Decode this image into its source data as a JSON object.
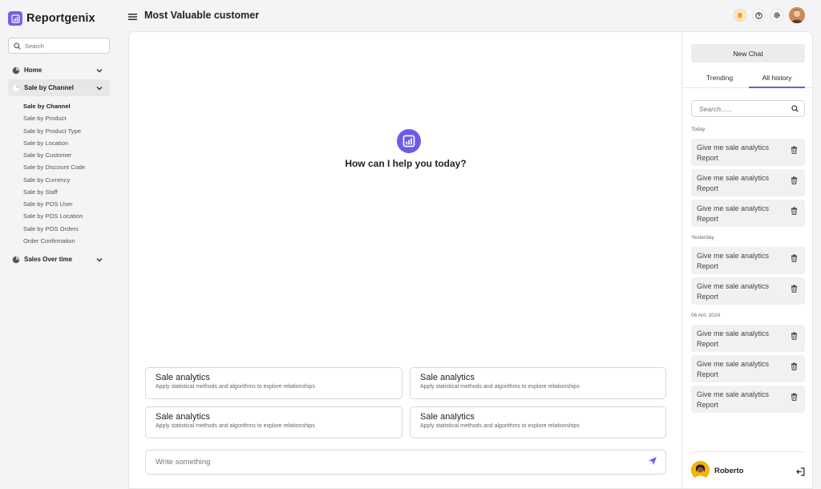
{
  "brand": {
    "name": "Reportgenix",
    "color": "#7262e8"
  },
  "sidebar": {
    "search_placeholder": "Search",
    "groups": [
      {
        "label": "Home"
      },
      {
        "label": "Sale by Channel"
      },
      {
        "label": "Sales Over time"
      }
    ],
    "sub_items": [
      "Sale by Channel",
      "Sale by Product",
      "Sale by Product Type",
      "Sale by Location",
      "Sale by Customer",
      "Sale by Discount Code",
      "Sale by Currency",
      "Sale by Staff",
      "Sale by POS User",
      "Sale by POS Location",
      "Sale by POS Orders",
      "Order Confirmation"
    ]
  },
  "header": {
    "title": "Most Valuable customer"
  },
  "main": {
    "greeting": "How can I help you today?",
    "cards": [
      {
        "title": "Sale analytics",
        "desc": "Apply statistical methods and algorithms to explore relationships"
      },
      {
        "title": "Sale analytics",
        "desc": "Apply statistical methods and algorithms to explore relationships"
      },
      {
        "title": "Sale analytics",
        "desc": "Apply statistical methods and algorithms to explore relationships"
      },
      {
        "title": "Sale analytics",
        "desc": "Apply statistical methods and algorithms to explore relationships"
      }
    ],
    "composer_placeholder": "Write something"
  },
  "history_panel": {
    "new_chat_label": "New Chat",
    "tabs": [
      "Trending",
      "All history"
    ],
    "active_tab": "All history",
    "search_placeholder": "Search......",
    "sections": [
      {
        "label": "Today",
        "items": [
          "Give me sale analytics Report",
          "Give me sale analytics Report",
          "Give me sale analytics Report"
        ]
      },
      {
        "label": "Yesterday",
        "items": [
          "Give me sale analytics Report",
          "Give me sale analytics Report"
        ]
      },
      {
        "label": "06 Aril, 2024",
        "items": [
          "Give me sale analytics Report",
          "Give me sale analytics Report",
          "Give me sale analytics Report"
        ]
      }
    ],
    "user_name": "Roberto"
  },
  "colors": {
    "accent": "#6b5ce7",
    "bell_bg": "#fde8c8"
  }
}
